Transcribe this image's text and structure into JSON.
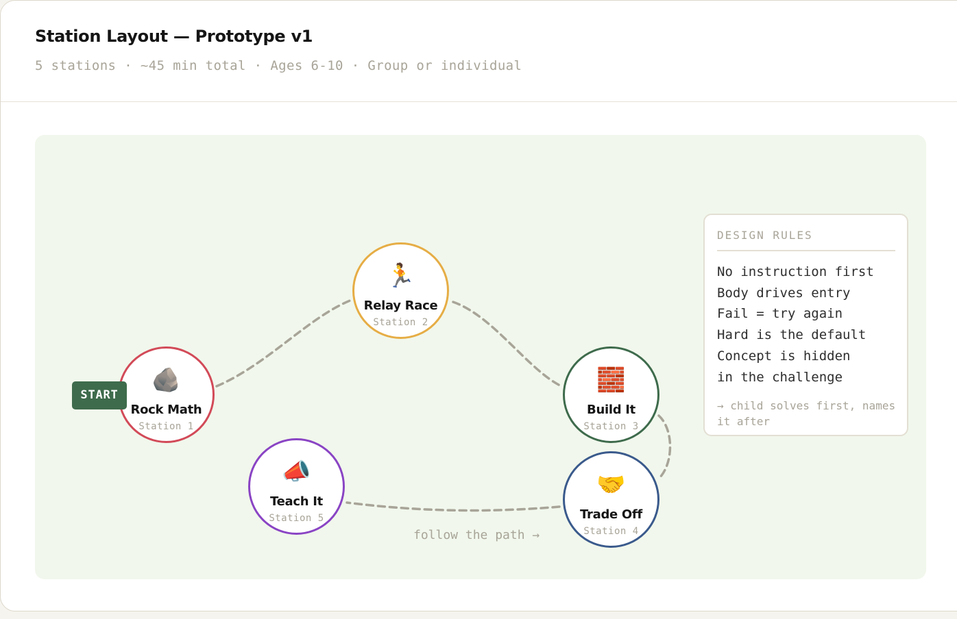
{
  "header": {
    "title": "Station Layout — Prototype v1",
    "subtitle": "5 stations · ~45 min total · Ages 6-10 · Group or individual"
  },
  "start_label": "START",
  "stations": [
    {
      "emoji": "🪨",
      "icon": "rock-icon",
      "name": "Rock Math",
      "station": "Station 1",
      "color": "#d24a58"
    },
    {
      "emoji": "🏃",
      "icon": "runner-icon",
      "name": "Relay Race",
      "station": "Station 2",
      "color": "#e6ad45"
    },
    {
      "emoji": "🧱",
      "icon": "bricks-icon",
      "name": "Build It",
      "station": "Station 3",
      "color": "#3e6b4c"
    },
    {
      "emoji": "🤝",
      "icon": "handshake-icon",
      "name": "Trade Off",
      "station": "Station 4",
      "color": "#3a5a8c"
    },
    {
      "emoji": "📣",
      "icon": "megaphone-icon",
      "name": "Teach It",
      "station": "Station 5",
      "color": "#8a44c4"
    }
  ],
  "path_label": "follow the path →",
  "design_rules": {
    "title": "DESIGN RULES",
    "items": [
      "No instruction first",
      "Body drives entry",
      "Fail = try again",
      "Hard is the default",
      "Concept is hidden",
      "in the challenge"
    ],
    "note": "→ child solves first, names it after"
  },
  "colors": {
    "canvas_bg": "#f1f7ec",
    "path": "#a8a498",
    "start_bg": "#3e6b4c"
  }
}
